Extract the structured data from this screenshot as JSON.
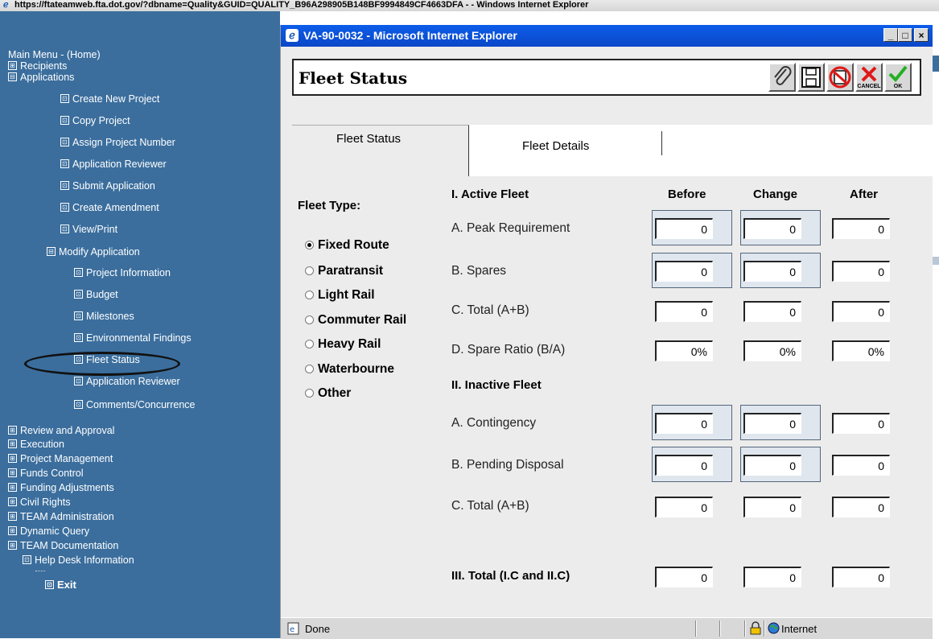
{
  "outer_window": {
    "title": "https://ftateamweb.fta.dot.gov/?dbname=Quality&GUID=QUALITY_B96A298905B148BF9994849CF4663DFA - - Windows Internet Explorer"
  },
  "sidebar": {
    "main_menu": "Main Menu - (Home)",
    "recipients": "Recipients",
    "applications": "Applications",
    "app_items": [
      "Create New Project",
      "Copy Project",
      "Assign Project Number",
      "Application Reviewer",
      "Submit Application",
      "Create Amendment",
      "View/Print"
    ],
    "modify_application": "Modify Application",
    "modify_items": [
      "Project Information",
      "Budget",
      "Milestones",
      "Environmental Findings",
      "Fleet Status",
      "Application Reviewer",
      "Comments/Concurrence"
    ],
    "sections": [
      "Review and Approval",
      "Execution",
      "Project Management",
      "Funds Control",
      "Funding Adjustments",
      "Civil Rights",
      "TEAM Administration",
      "Dynamic Query",
      "TEAM Documentation"
    ],
    "help_desk": "Help Desk Information",
    "exit": "Exit",
    "expand_glyph": "⊞",
    "collapse_glyph": "⊟",
    "bullet_glyph": "⊡"
  },
  "popup": {
    "title": "VA-90-0032 - Microsoft Internet Explorer",
    "page_title": "Fleet Status",
    "toolbar": {
      "cancel_label": "CANCEL",
      "ok_label": "OK"
    },
    "tabs": [
      {
        "label": "Fleet Status",
        "active": true
      },
      {
        "label": "Fleet Details",
        "active": false
      }
    ],
    "fleet_type_label": "Fleet Type:",
    "fleet_types": [
      "Fixed Route",
      "Paratransit",
      "Light Rail",
      "Commuter Rail",
      "Heavy Rail",
      "Waterbourne",
      "Other"
    ],
    "selected_fleet_type": "Fixed Route",
    "columns": [
      "Before",
      "Change",
      "After"
    ],
    "section1_title": "I. Active Fleet",
    "section2_title": "II. Inactive Fleet",
    "section3_title": "III. Total (I.C and II.C)",
    "active_rows": [
      {
        "label": "A. Peak Requirement",
        "before": "0",
        "change": "0",
        "after": "0"
      },
      {
        "label": "B. Spares",
        "before": "0",
        "change": "0",
        "after": "0"
      },
      {
        "label": "C. Total (A+B)",
        "before": "0",
        "change": "0",
        "after": "0"
      },
      {
        "label": "D. Spare Ratio (B/A)",
        "before": "0%",
        "change": "0%",
        "after": "0%"
      }
    ],
    "inactive_rows": [
      {
        "label": "A. Contingency",
        "before": "0",
        "change": "0",
        "after": "0"
      },
      {
        "label": "B. Pending Disposal",
        "before": "0",
        "change": "0",
        "after": "0"
      },
      {
        "label": "C. Total (A+B)",
        "before": "0",
        "change": "0",
        "after": "0"
      }
    ],
    "total_row": {
      "before": "0",
      "change": "0",
      "after": "0"
    },
    "status": {
      "text": "Done",
      "zone": "Internet"
    }
  },
  "colors": {
    "sidebar_bg": "#3b6e9d",
    "titlebar_blue": "#0a47c8",
    "panel_bg": "#ececec"
  }
}
